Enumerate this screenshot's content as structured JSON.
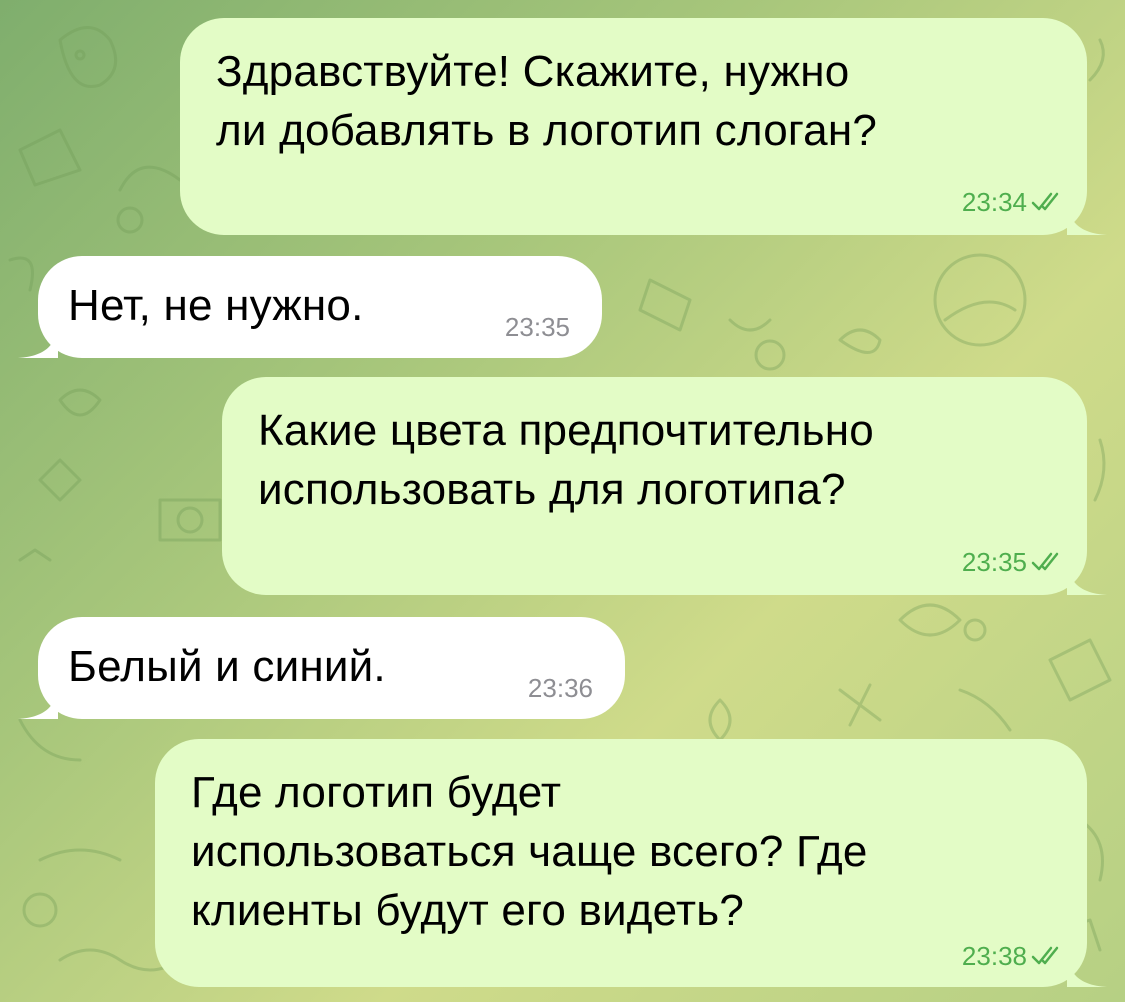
{
  "chat": {
    "messages": [
      {
        "direction": "outgoing",
        "text": "Здравствуйте! Скажите, нужно\nли добавлять в логотип слоган?",
        "time": "23:34",
        "status": "read"
      },
      {
        "direction": "incoming",
        "text": "Нет, не нужно.",
        "time": "23:35"
      },
      {
        "direction": "outgoing",
        "text": "Какие цвета предпочтительно\nиспользовать для логотипа?",
        "time": "23:35",
        "status": "read"
      },
      {
        "direction": "incoming",
        "text": "Белый и синий.",
        "time": "23:36"
      },
      {
        "direction": "outgoing",
        "text": "Где логотип будет\nиспользоваться чаще всего? Где\nклиенты будут его видеть?",
        "time": "23:38",
        "status": "read"
      }
    ]
  },
  "colors": {
    "outgoing_bubble": "#e3fcc6",
    "incoming_bubble": "#ffffff",
    "outgoing_meta": "#4fae4e",
    "incoming_meta": "#8e8e93"
  },
  "icons": {
    "read_receipt": "double-check-icon"
  }
}
